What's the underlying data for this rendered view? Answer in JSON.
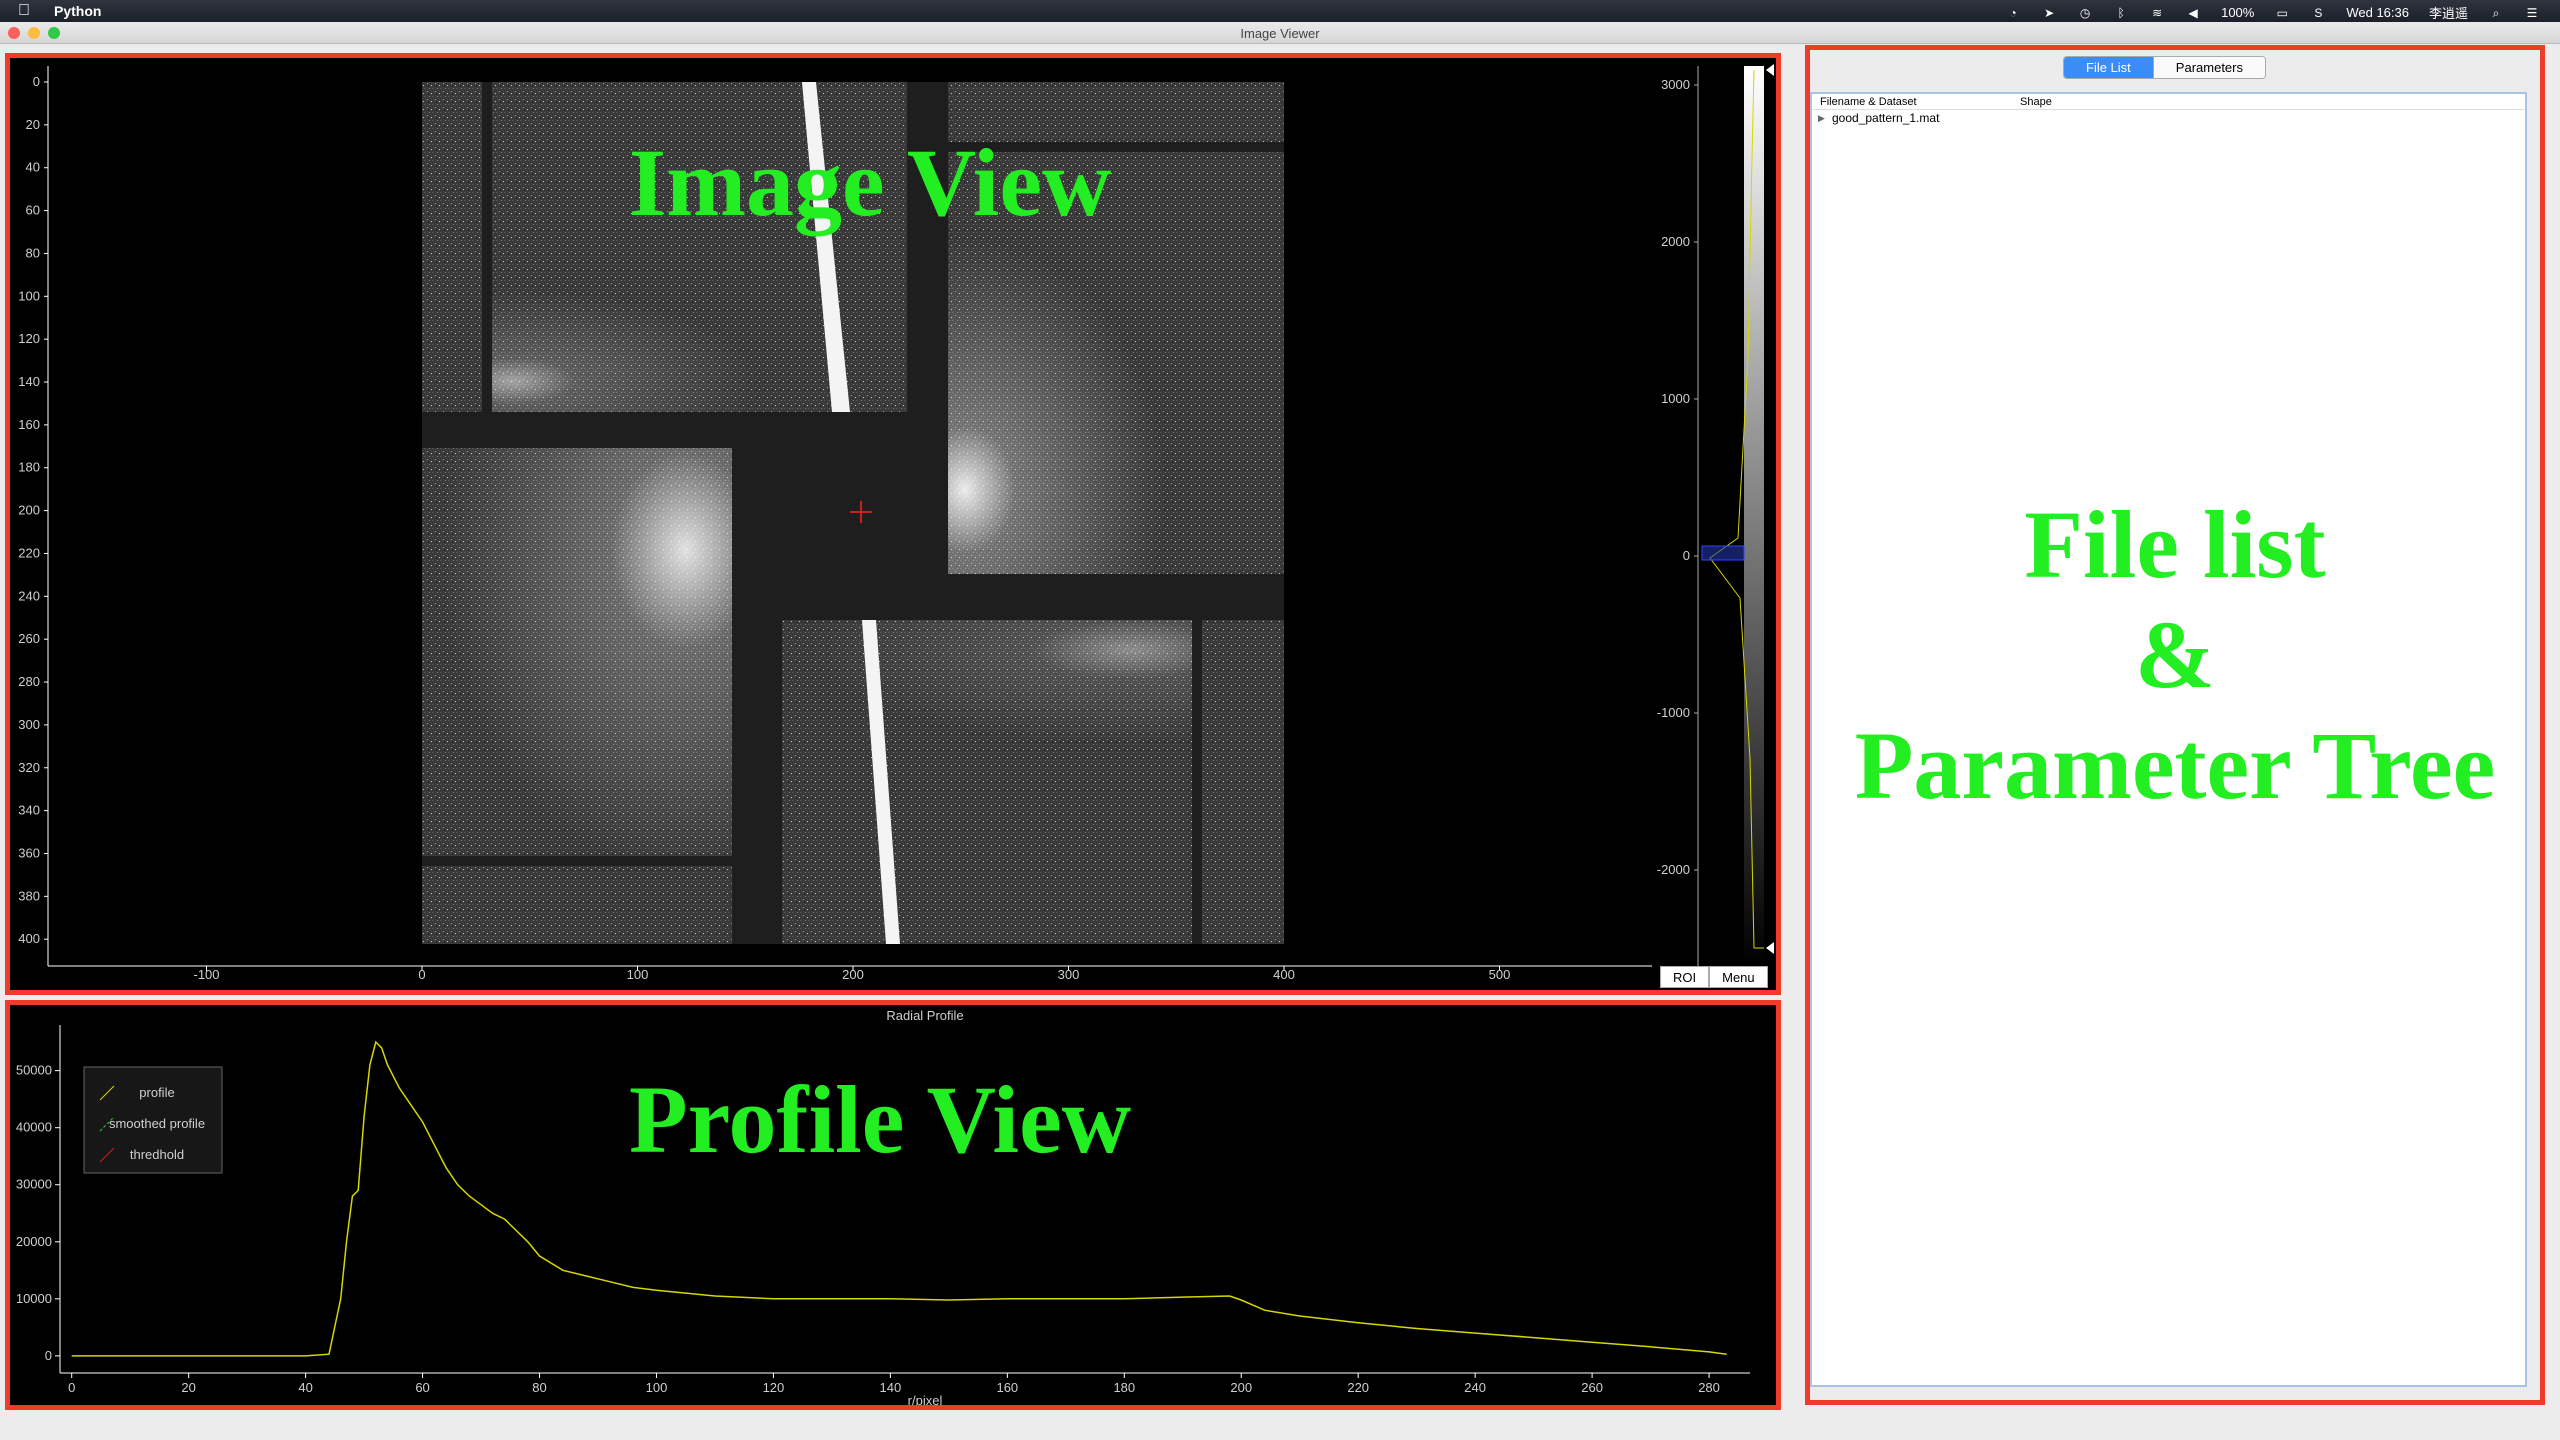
{
  "menubar": {
    "app_name": "Python",
    "battery": "100%",
    "datetime": "Wed 16:36",
    "user": "李逍遥"
  },
  "window": {
    "title": "Image Viewer",
    "traffic_colors": [
      "#fc605c",
      "#fdbc40",
      "#34c84a"
    ]
  },
  "image_view": {
    "label": "Image View",
    "x_ticks": [
      -100,
      0,
      100,
      200,
      300,
      400,
      500
    ],
    "y_ticks": [
      0,
      20,
      40,
      60,
      80,
      100,
      120,
      140,
      160,
      180,
      200,
      220,
      240,
      260,
      280,
      300,
      320,
      340,
      360,
      380,
      400
    ],
    "histogram_ticks": [
      3000,
      2000,
      1000,
      0,
      -1000,
      -2000
    ],
    "roi_label": "ROI",
    "menu_label": "Menu",
    "center_marker_color": "#c8201c"
  },
  "profile_view": {
    "label": "Profile View",
    "legend": [
      "profile",
      "smoothed profile",
      "thredhold"
    ]
  },
  "chart_data": {
    "type": "line",
    "title": "Radial Profile",
    "xlabel": "r/pixel",
    "ylabel": "",
    "xlim": [
      -2,
      287
    ],
    "ylim": [
      -3000,
      58000
    ],
    "x_ticks": [
      0,
      20,
      40,
      60,
      80,
      100,
      120,
      140,
      160,
      180,
      200,
      220,
      240,
      260,
      280
    ],
    "y_ticks": [
      0,
      10000,
      20000,
      30000,
      40000,
      50000
    ],
    "series": [
      {
        "name": "profile",
        "color": "#d6d600",
        "x": [
          0,
          10,
          20,
          30,
          40,
          44,
          46,
          47,
          48,
          49,
          50,
          51,
          52,
          53,
          54,
          56,
          58,
          60,
          62,
          64,
          66,
          68,
          70,
          72,
          74,
          76,
          78,
          80,
          84,
          88,
          92,
          96,
          100,
          110,
          120,
          130,
          140,
          150,
          160,
          170,
          180,
          190,
          198,
          200,
          204,
          210,
          220,
          230,
          240,
          250,
          260,
          270,
          280,
          283
        ],
        "y": [
          0,
          0,
          0,
          0,
          0,
          300,
          10000,
          20000,
          28000,
          29000,
          42000,
          51000,
          55000,
          54000,
          51000,
          47000,
          44000,
          41000,
          37000,
          33000,
          30000,
          28000,
          26500,
          25000,
          24000,
          22000,
          20000,
          17500,
          15000,
          14000,
          13000,
          12000,
          11500,
          10500,
          10000,
          10000,
          10000,
          9800,
          10000,
          10000,
          10000,
          10300,
          10500,
          9800,
          8000,
          7000,
          5800,
          4800,
          4000,
          3200,
          2400,
          1600,
          700,
          300
        ]
      },
      {
        "name": "smoothed profile",
        "color": "#22cc22",
        "x": [],
        "y": []
      },
      {
        "name": "thredhold",
        "color": "#cc2222",
        "x": [],
        "y": []
      }
    ]
  },
  "right_panel": {
    "label_line1": "File list",
    "label_line2": "&",
    "label_line3": "Parameter Tree",
    "tabs": [
      "File List",
      "Parameters"
    ],
    "columns": [
      "Filename & Dataset",
      "Shape"
    ],
    "files": [
      {
        "name": "good_pattern_1.mat",
        "shape": ""
      }
    ]
  }
}
